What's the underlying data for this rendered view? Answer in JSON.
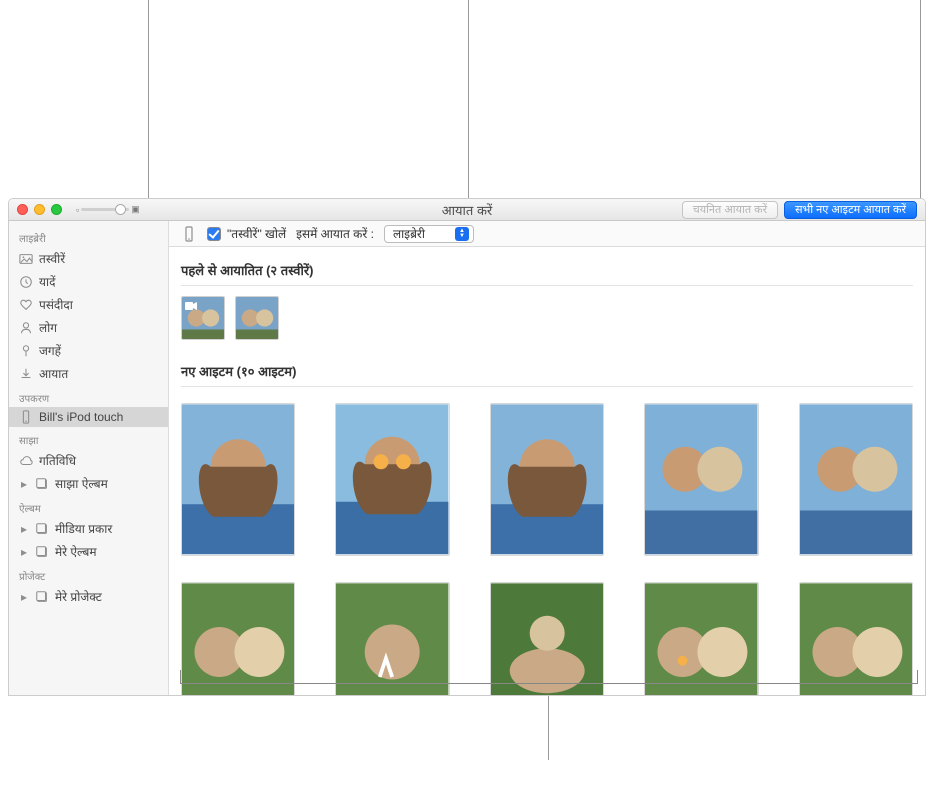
{
  "window_title": "आयात करें",
  "toolbar": {
    "import_selected": "चयनित आयात करें",
    "import_all_new": "सभी नए आइटम आयात करें"
  },
  "controls": {
    "open_photos_label": "\"तस्वीरें\" खोलें",
    "import_into_label": "इसमें आयात करें :",
    "import_into_value": "लाइब्रेरी"
  },
  "sidebar": {
    "library_header": "लाइब्रेरी",
    "library_items": [
      {
        "label": "तस्वीरें",
        "icon": "photos"
      },
      {
        "label": "यादें",
        "icon": "memories"
      },
      {
        "label": "पसंदीदा",
        "icon": "favorites"
      },
      {
        "label": "लोग",
        "icon": "people"
      },
      {
        "label": "जगहें",
        "icon": "places"
      },
      {
        "label": "आयात",
        "icon": "import"
      }
    ],
    "devices_header": "उपकरण",
    "device_label": "Bill's iPod touch",
    "shared_header": "साझा",
    "shared_items": [
      {
        "label": "गतिविधि",
        "icon": "cloud",
        "disclosure": false
      },
      {
        "label": "साझा ऐल्बम",
        "icon": "album",
        "disclosure": true
      }
    ],
    "albums_header": "ऐल्बम",
    "album_items": [
      {
        "label": "मीडिया प्रकार",
        "icon": "album",
        "disclosure": true
      },
      {
        "label": "मेरे ऐल्बम",
        "icon": "album",
        "disclosure": true
      }
    ],
    "projects_header": "प्रोजेक्ट",
    "project_items": [
      {
        "label": "मेरे प्रोजेक्ट",
        "icon": "album",
        "disclosure": true
      }
    ]
  },
  "sections": {
    "already_imported": "पहले से आयातित (२ तस्वीरें)",
    "new_items": "नए आइटम (१० आइटम)"
  }
}
